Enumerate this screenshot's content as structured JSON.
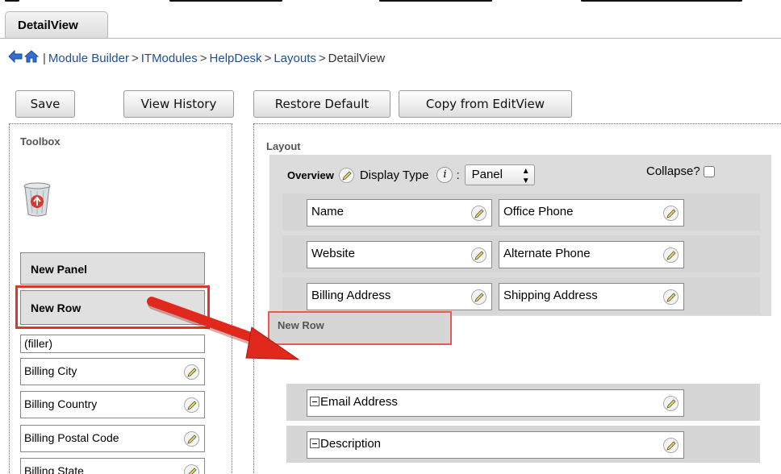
{
  "tab": {
    "label": "DetailView"
  },
  "breadcrumb": {
    "items": [
      "Module Builder",
      "ITModules",
      "HelpDesk",
      "Layouts"
    ],
    "separator": ">",
    "current": "DetailView"
  },
  "toolbar": {
    "save": "Save",
    "view_history": "View History",
    "restore_default": "Restore Default",
    "copy_from_editview": "Copy from EditView"
  },
  "toolbox": {
    "title": "Toolbox",
    "new_panel": "New Panel",
    "new_row": "New Row",
    "filler": "(filler)",
    "fields": [
      "Billing City",
      "Billing Country",
      "Billing Postal Code",
      "Billing State"
    ]
  },
  "layout": {
    "title": "Layout",
    "panel_name": "Overview",
    "display_type_label": "Display Type",
    "display_type_colon": ":",
    "display_type_value": "Panel",
    "collapse_label": "Collapse?",
    "rows": [
      [
        "Name",
        "Office Phone"
      ],
      [
        "Website",
        "Alternate Phone"
      ],
      [
        "Billing Address",
        "Shipping Address"
      ]
    ],
    "new_row_label": "New Row",
    "full_rows": [
      "Email Address",
      "Description"
    ]
  },
  "colors": {
    "link": "#1f4f94",
    "highlight_red": "#e0362a",
    "panel_grey": "#dcdcdc"
  }
}
